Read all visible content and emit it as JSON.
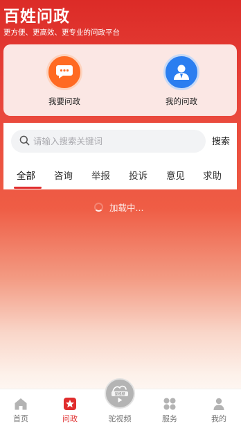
{
  "header": {
    "title": "百姓问政",
    "subtitle": "更方便、更高效、更专业的问政平台"
  },
  "quick_actions": [
    {
      "label": "我要问政",
      "icon": "chat-bubble-icon"
    },
    {
      "label": "我的问政",
      "icon": "user-profile-icon"
    }
  ],
  "search": {
    "placeholder": "请输入搜索关键词",
    "value": "",
    "button_label": "搜索"
  },
  "tabs": [
    {
      "label": "全部",
      "active": true
    },
    {
      "label": "咨询",
      "active": false
    },
    {
      "label": "举报",
      "active": false
    },
    {
      "label": "投诉",
      "active": false
    },
    {
      "label": "意见",
      "active": false
    },
    {
      "label": "求助",
      "active": false
    }
  ],
  "loading": {
    "text": "加载中..."
  },
  "tabbar": {
    "items": [
      {
        "label": "首页",
        "icon": "home-icon",
        "active": false
      },
      {
        "label": "问政",
        "icon": "star-badge-icon",
        "active": true
      },
      {
        "label": "驼视频",
        "icon": "video-play-icon",
        "active": false
      },
      {
        "label": "服务",
        "icon": "grid-apps-icon",
        "active": false
      },
      {
        "label": "我的",
        "icon": "person-icon",
        "active": false
      }
    ],
    "video_badge": "爱视频"
  },
  "colors": {
    "brand_red": "#e02d2d",
    "orange": "#ff6a22",
    "blue": "#2b7ef0"
  }
}
